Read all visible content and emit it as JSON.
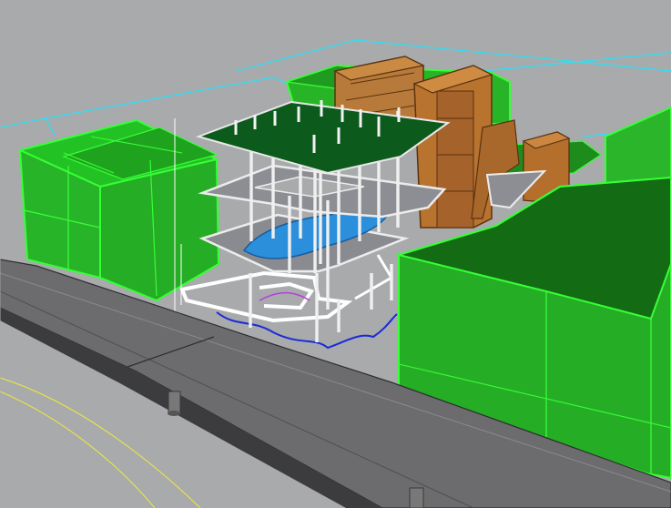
{
  "app": {
    "viewport_name": ""
  },
  "colors": {
    "background": "#a8aaac",
    "mass_green": "#22b322",
    "mass_green_dark": "#146d14",
    "mass_edge": "#36ff36",
    "floor_slab": "#8b8c92",
    "floor_edge": "#e8e8e8",
    "roof_slab": "#0c5a1c",
    "brick_orange": "#b5702a",
    "brick_dark": "#7a4416",
    "road": "#6c6c6f",
    "road_dark": "#3e3e40",
    "cyan_lines": "#36dcf0",
    "yellow_lines": "#e7e24a",
    "blue_curve": "#1a2bd6",
    "water_blue": "#2c8fdc"
  },
  "scene": {
    "objects": [
      "green-mass-left",
      "green-mass-right",
      "green-mass-back",
      "skeleton-tower",
      "brick-tower",
      "elevated-road",
      "site-boundary"
    ]
  }
}
